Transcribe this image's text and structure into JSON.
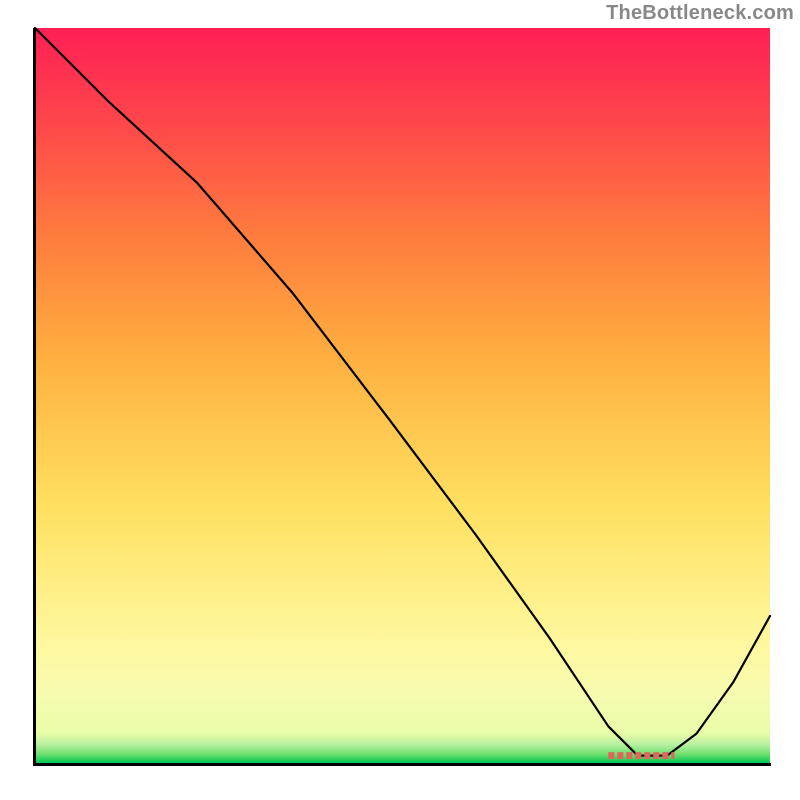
{
  "watermark": "TheBottleneck.com",
  "chart_data": {
    "type": "line",
    "title": "",
    "xlabel": "",
    "ylabel": "",
    "xlim": [
      0,
      100
    ],
    "ylim": [
      0,
      100
    ],
    "grid": false,
    "series": [
      {
        "name": "curve",
        "x": [
          0,
          10,
          22,
          35,
          48,
          60,
          70,
          78,
          82,
          86,
          90,
          95,
          100
        ],
        "y": [
          100,
          90,
          79,
          64,
          47,
          31,
          17,
          5,
          1,
          1,
          4,
          11,
          20
        ]
      }
    ],
    "annotations": [
      {
        "name": "optimal-range-marker",
        "type": "segment",
        "x_start": 78,
        "x_end": 87,
        "y": 1,
        "style": "dashed-red"
      }
    ],
    "background": {
      "type": "vertical-gradient",
      "stops": [
        {
          "y": 0,
          "color": "#00c853"
        },
        {
          "y": 4,
          "color": "#e8fca8"
        },
        {
          "y": 16,
          "color": "#fff8a0"
        },
        {
          "y": 55,
          "color": "#ffb040"
        },
        {
          "y": 86,
          "color": "#ff4a4a"
        },
        {
          "y": 100,
          "color": "#ff1f55"
        }
      ]
    }
  }
}
